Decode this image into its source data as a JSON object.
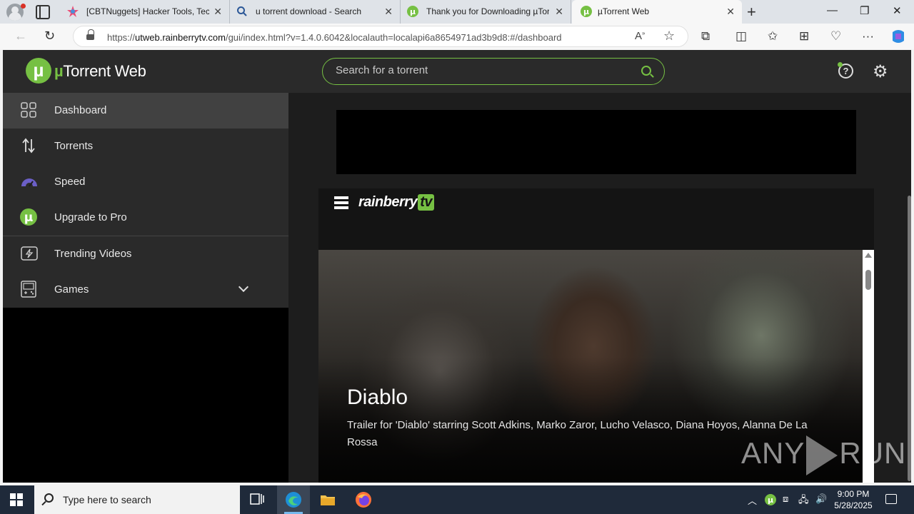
{
  "browser": {
    "tabs": [
      {
        "title": "[CBTNuggets] Hacker Tools, Tech",
        "favicon": "cbtnuggets-icon"
      },
      {
        "title": "u torrent download - Search",
        "favicon": "search-icon"
      },
      {
        "title": "Thank you for Downloading µTor",
        "favicon": "utorrent-icon"
      },
      {
        "title": "µTorrent Web",
        "favicon": "utorrent-icon"
      }
    ],
    "url_prefix": "https://",
    "url_host": "utweb.rainberrytv.com",
    "url_path": "/gui/index.html?v=1.4.0.6042&localauth=localapi6a8654971ad3b9d8:#/dashboard"
  },
  "app": {
    "logo_mu": "µ",
    "logo_rest": "Torrent Web",
    "search_placeholder": "Search for a torrent",
    "sidebar": [
      {
        "label": "Dashboard",
        "icon": "grid-icon",
        "active": true
      },
      {
        "label": "Torrents",
        "icon": "up-down-arrows-icon"
      },
      {
        "label": "Speed",
        "icon": "speedometer-icon"
      },
      {
        "label": "Upgrade to Pro",
        "icon": "utorrent-icon"
      },
      {
        "label": "Trending Videos",
        "icon": "lightning-video-icon"
      },
      {
        "label": "Games",
        "icon": "gamepad-icon"
      }
    ],
    "rainberry": {
      "logo_text": "rainberry",
      "logo_badge": "tv"
    },
    "video": {
      "title": "Diablo",
      "description": "Trailer for 'Diablo' starring Scott Adkins, Marko Zaror, Lucho Velasco, Diana Hoyos, Alanna De La Rossa"
    },
    "watermark": {
      "left": "ANY",
      "right": "RUN"
    }
  },
  "taskbar": {
    "search_placeholder": "Type here to search",
    "time": "9:00 PM",
    "date": "5/28/2025"
  },
  "colors": {
    "accent": "#76c043",
    "header_bg": "#2a2a2a",
    "sidebar_active": "#414141"
  }
}
